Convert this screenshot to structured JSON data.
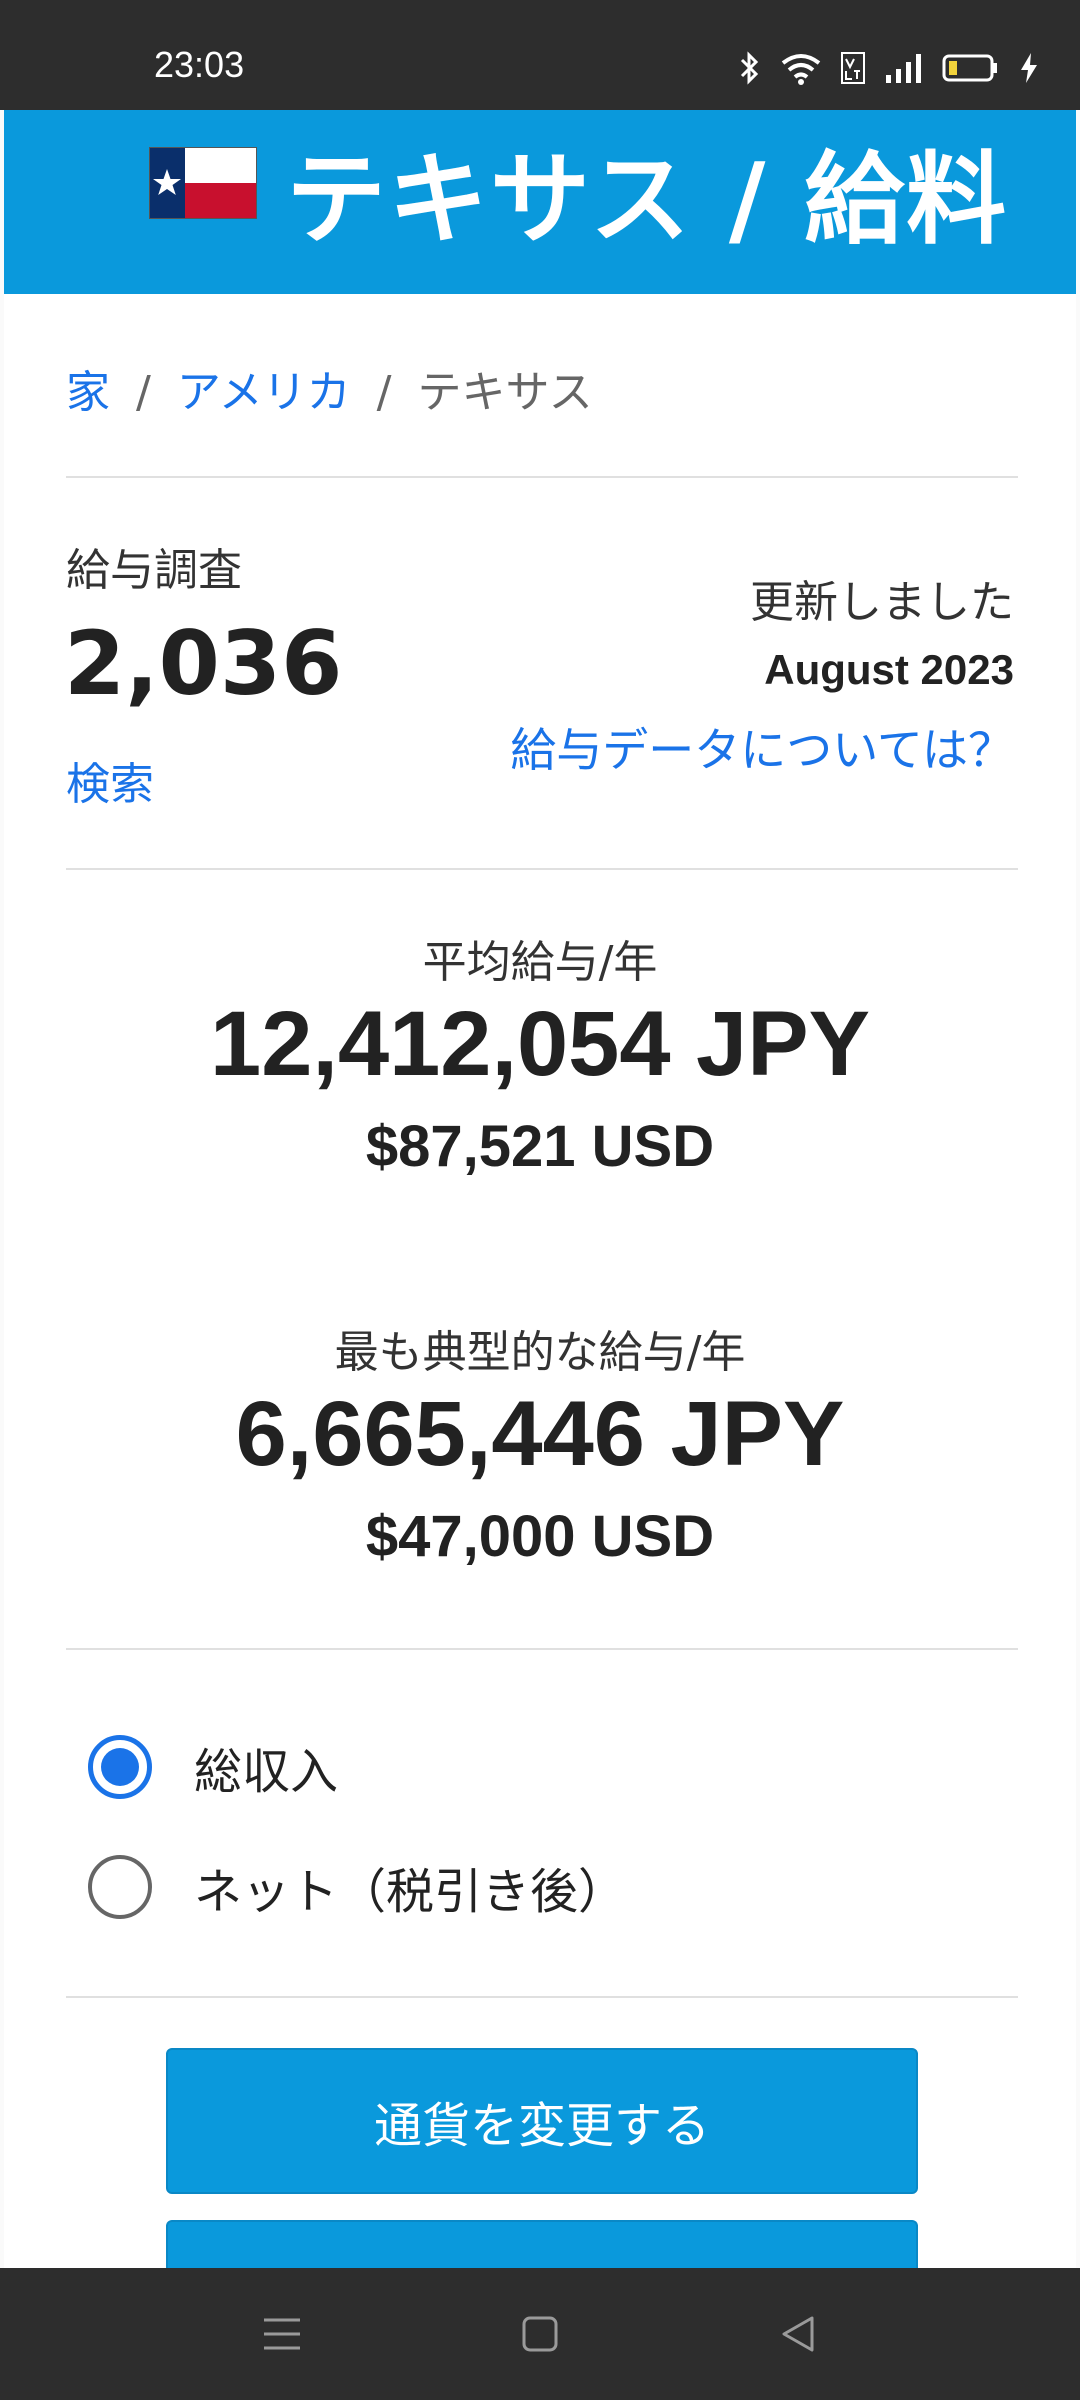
{
  "status_bar": {
    "time": "23:03"
  },
  "header": {
    "title": "テキサス / 給料"
  },
  "breadcrumb": {
    "home": "家",
    "sep": "/",
    "country": "アメリカ",
    "current": "テキサス"
  },
  "survey": {
    "label": "給与調査",
    "count": "2,036",
    "search_link": "検索"
  },
  "updated": {
    "label": "更新しました",
    "date": "August 2023",
    "about_link": "給与データについては？"
  },
  "average": {
    "label": "平均給与/年",
    "jpy": "12,412,054 JPY",
    "usd": "$87,521 USD"
  },
  "typical": {
    "label": "最も典型的な給与/年",
    "jpy": "6,665,446 JPY",
    "usd": "$47,000 USD"
  },
  "income_options": [
    {
      "label": "総収入",
      "selected": true
    },
    {
      "label": "ネット（税引き後）",
      "selected": false
    }
  ],
  "buttons": {
    "change_currency": "通貨を変更する",
    "second": ""
  },
  "colors": {
    "brand": "#0a99dc",
    "link": "#1a73e8",
    "bars": "#2d2d2d"
  }
}
